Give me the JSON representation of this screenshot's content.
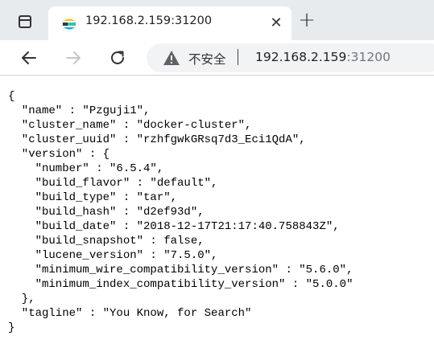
{
  "tab": {
    "title": "192.168.2.159:31200",
    "close_glyph": "✕",
    "new_tab_glyph": "+",
    "favicon": "elasticsearch-icon"
  },
  "toolbar": {
    "back_icon": "back-arrow-icon",
    "forward_icon": "forward-arrow-icon",
    "reload_icon": "reload-icon",
    "security_label": "不安全",
    "url_host": "192.168.2.159",
    "url_port": ":31200"
  },
  "json_lines": [
    "{",
    "  \"name\" : \"Pzguji1\",",
    "  \"cluster_name\" : \"docker-cluster\",",
    "  \"cluster_uuid\" : \"rzhfgwkGRsq7d3_Eci1QdA\",",
    "  \"version\" : {",
    "    \"number\" : \"6.5.4\",",
    "    \"build_flavor\" : \"default\",",
    "    \"build_type\" : \"tar\",",
    "    \"build_hash\" : \"d2ef93d\",",
    "    \"build_date\" : \"2018-12-17T21:17:40.758843Z\",",
    "    \"build_snapshot\" : false,",
    "    \"lucene_version\" : \"7.5.0\",",
    "    \"minimum_wire_compatibility_version\" : \"5.6.0\",",
    "    \"minimum_index_compatibility_version\" : \"5.0.0\"",
    "  },",
    "  \"tagline\" : \"You Know, for Search\"",
    "}"
  ]
}
